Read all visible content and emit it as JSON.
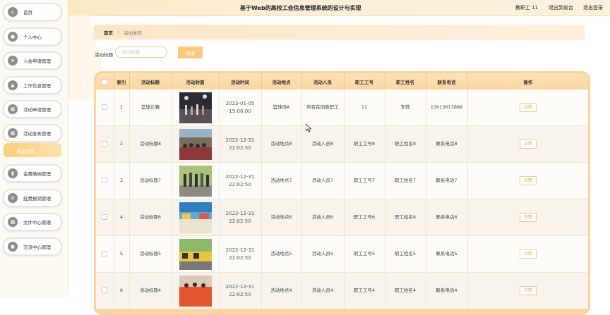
{
  "header": {
    "title": "基于Web的高校工会信息管理系统的设计与实现",
    "user": "教职工 11",
    "back_label": "退出到前台",
    "logout_label": "退出登录"
  },
  "sidebar": {
    "items": [
      {
        "label": "首页",
        "icon": "home-icon"
      },
      {
        "label": "个人中心",
        "icon": "user-icon"
      },
      {
        "label": "入会申请管理",
        "icon": "send-icon"
      },
      {
        "label": "工作信息管理",
        "icon": "person-icon"
      },
      {
        "label": "活动申请管理",
        "icon": "grid-icon"
      },
      {
        "label": "活动发布管理",
        "icon": "grid-icon"
      },
      {
        "label": "活动发布",
        "icon": ""
      },
      {
        "label": "会费缴纳管理",
        "icon": "chart-icon"
      },
      {
        "label": "经费报销管理",
        "icon": "list-icon"
      },
      {
        "label": "文件中心管理",
        "icon": "grid-icon"
      },
      {
        "label": "交流中心管理",
        "icon": "chat-icon"
      }
    ]
  },
  "breadcrumb": {
    "home": "首页",
    "separator": "/",
    "current": "活动发布"
  },
  "search": {
    "label": "活动标题",
    "placeholder": "活动标题",
    "value": "",
    "button": "搜索"
  },
  "table": {
    "headers": [
      "索引",
      "活动标题",
      "活动封面",
      "活动时间",
      "活动地点",
      "活动人员",
      "职工工号",
      "职工姓名",
      "联系电话",
      "操作"
    ],
    "detail_label": "详情",
    "rows": [
      {
        "index": "1",
        "title": "篮球比赛",
        "time": "2023-01-05 15:00:00",
        "place": "篮球场A",
        "people": "所有在岗教职工",
        "staff_no": "11",
        "staff_name": "李莉",
        "phone": "13613613688"
      },
      {
        "index": "2",
        "title": "活动标题8",
        "time": "2022-12-31 22:02:50",
        "place": "活动地点8",
        "people": "活动人员8",
        "staff_no": "职工工号8",
        "staff_name": "职工姓名8",
        "phone": "联系电话8"
      },
      {
        "index": "3",
        "title": "活动标题7",
        "time": "2022-12-31 22:02:50",
        "place": "活动地点7",
        "people": "活动人员7",
        "staff_no": "职工工号7",
        "staff_name": "职工姓名7",
        "phone": "联系电话7"
      },
      {
        "index": "4",
        "title": "活动标题6",
        "time": "2022-12-31 22:02:50",
        "place": "活动地点6",
        "people": "活动人员6",
        "staff_no": "职工工号6",
        "staff_name": "职工姓名6",
        "phone": "联系电话6"
      },
      {
        "index": "5",
        "title": "活动标题5",
        "time": "2022-12-31 22:02:50",
        "place": "活动地点5",
        "people": "活动人员5",
        "staff_no": "职工工号5",
        "staff_name": "职工姓名5",
        "phone": "联系电话5"
      },
      {
        "index": "6",
        "title": "活动标题4",
        "time": "2022-12-31 22:02:50",
        "place": "活动地点4",
        "people": "活动人员4",
        "staff_no": "职工工号4",
        "staff_name": "职工姓名4",
        "phone": "联系电话4"
      }
    ]
  },
  "colors": {
    "accent": "#fbc97c",
    "accent_light": "#fde3b8",
    "active_nav": "#f9d07c"
  }
}
